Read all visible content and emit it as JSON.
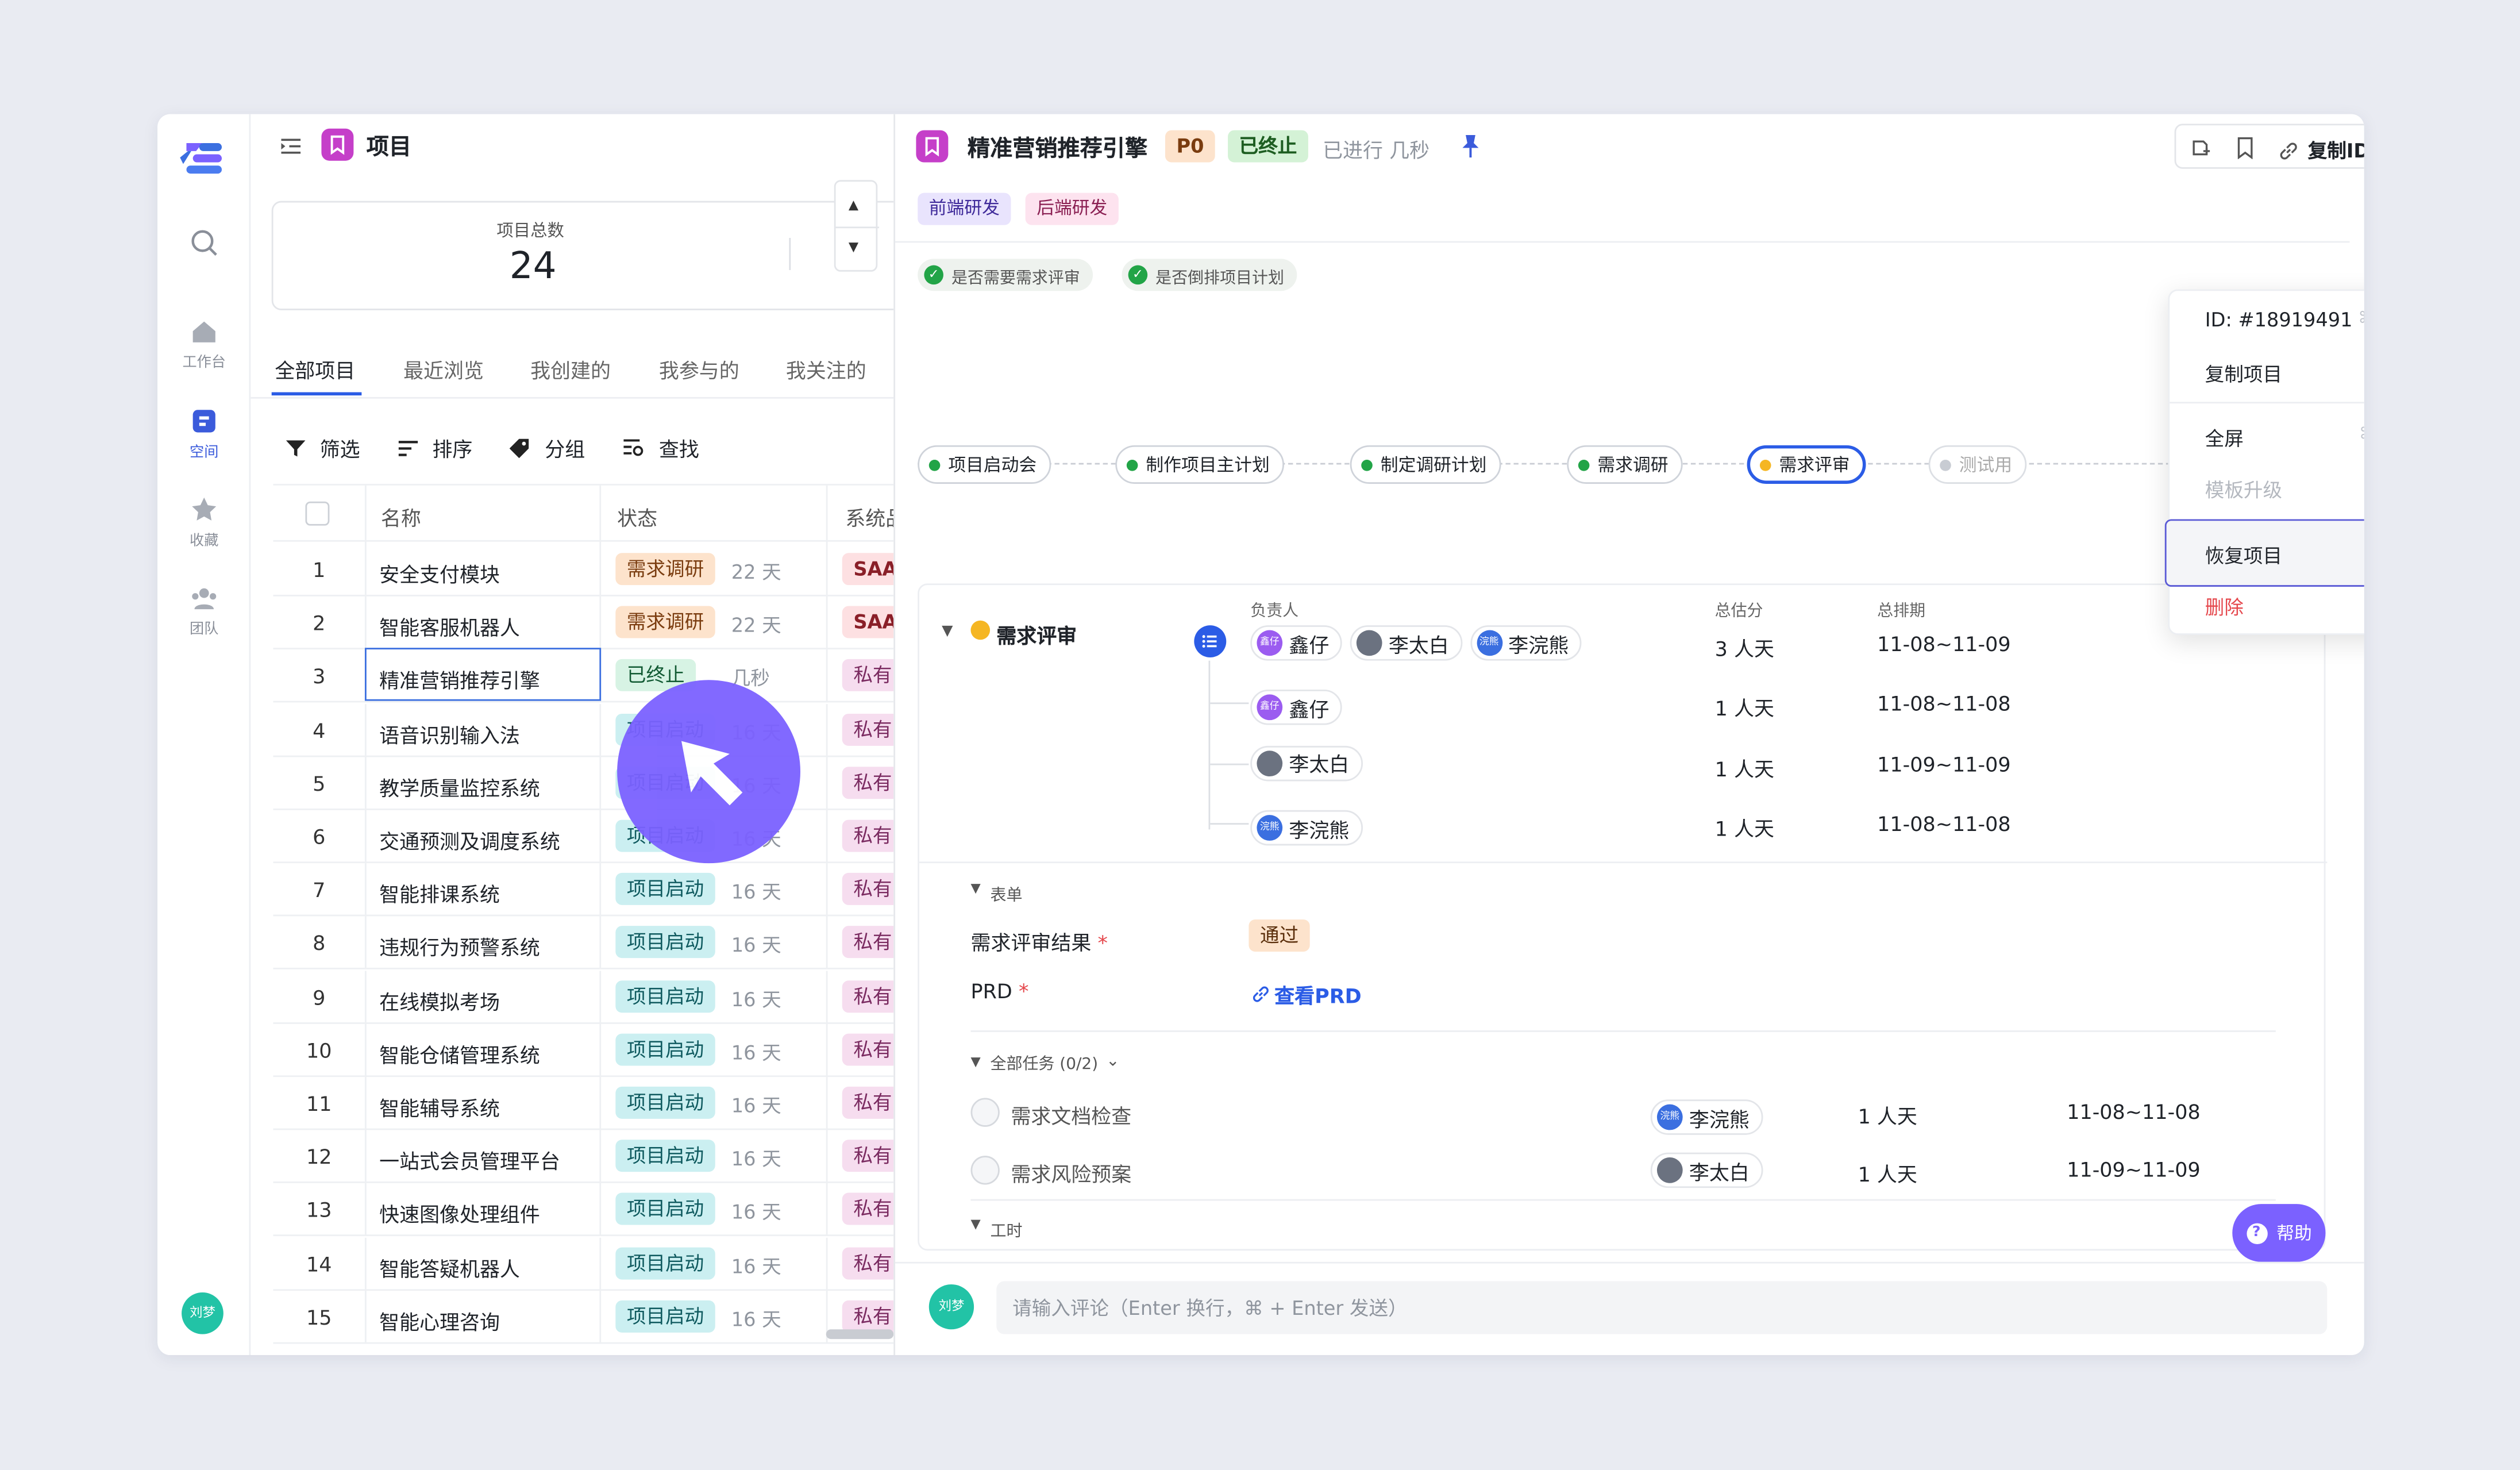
{
  "rail": {
    "items": [
      "工作台",
      "空间",
      "收藏",
      "团队"
    ],
    "user": "刘梦"
  },
  "left": {
    "title": "项目",
    "summary": {
      "label": "项目总数",
      "value": "24"
    },
    "tabs": [
      "全部项目",
      "最近浏览",
      "我创建的",
      "我参与的",
      "我关注的"
    ],
    "toolbar": {
      "filter": "筛选",
      "sort": "排序",
      "group": "分组",
      "find": "查找"
    },
    "columns": {
      "name": "名称",
      "status": "状态",
      "system": "系统品"
    },
    "rows": [
      {
        "no": "1",
        "name": "安全支付模块",
        "status": "需求调研",
        "days": "22 天",
        "sys": "SAA"
      },
      {
        "no": "2",
        "name": "智能客服机器人",
        "status": "需求调研",
        "days": "22 天",
        "sys": "SAA"
      },
      {
        "no": "3",
        "name": "精准营销推荐引擎",
        "status": "已终止",
        "days": "几秒",
        "sys": "私有"
      },
      {
        "no": "4",
        "name": "语音识别输入法",
        "status": "项目启动",
        "days": "16 天",
        "sys": "私有"
      },
      {
        "no": "5",
        "name": "教学质量监控系统",
        "status": "项目启动",
        "days": "16 天",
        "sys": "私有"
      },
      {
        "no": "6",
        "name": "交通预测及调度系统",
        "status": "项目启动",
        "days": "16 天",
        "sys": "私有"
      },
      {
        "no": "7",
        "name": "智能排课系统",
        "status": "项目启动",
        "days": "16 天",
        "sys": "私有"
      },
      {
        "no": "8",
        "name": "违规行为预警系统",
        "status": "项目启动",
        "days": "16 天",
        "sys": "私有"
      },
      {
        "no": "9",
        "name": "在线模拟考场",
        "status": "项目启动",
        "days": "16 天",
        "sys": "私有"
      },
      {
        "no": "10",
        "name": "智能仓储管理系统",
        "status": "项目启动",
        "days": "16 天",
        "sys": "私有"
      },
      {
        "no": "11",
        "name": "智能辅导系统",
        "status": "项目启动",
        "days": "16 天",
        "sys": "私有"
      },
      {
        "no": "12",
        "name": "一站式会员管理平台",
        "status": "项目启动",
        "days": "16 天",
        "sys": "私有"
      },
      {
        "no": "13",
        "name": "快速图像处理组件",
        "status": "项目启动",
        "days": "16 天",
        "sys": "私有"
      },
      {
        "no": "14",
        "name": "智能答疑机器人",
        "status": "项目启动",
        "days": "16 天",
        "sys": "私有"
      },
      {
        "no": "15",
        "name": "智能心理咨询",
        "status": "项目启动",
        "days": "16 天",
        "sys": "私有"
      }
    ]
  },
  "detail": {
    "title": "精准营销推荐引擎",
    "priority": "P0",
    "status": "已终止",
    "elapsed": "已进行 几秒",
    "copy_id": "复制ID",
    "tags": [
      "前端研发",
      "后端研发"
    ],
    "checks": [
      "是否需要需求评审",
      "是否倒排项目计划"
    ],
    "pipeline": [
      {
        "label": "项目启动会",
        "color": "#22a447"
      },
      {
        "label": "制作项目主计划",
        "color": "#22a447"
      },
      {
        "label": "制定调研计划",
        "color": "#22a447"
      },
      {
        "label": "需求调研",
        "color": "#22a447"
      },
      {
        "label": "需求评审",
        "color": "#f5b623"
      },
      {
        "label": "测试用",
        "color": "#c8ccd3"
      }
    ],
    "stage": {
      "name": "需求评审",
      "headers": {
        "owner": "负责人",
        "estimate": "总估分",
        "schedule": "总排期"
      },
      "owners": [
        "鑫仔",
        "李太白",
        "李浣熊"
      ],
      "total": {
        "estimate": "3 人天",
        "schedule": "11-08~11-09"
      },
      "subs": [
        {
          "owner": "鑫仔",
          "estimate": "1 人天",
          "schedule": "11-08~11-08"
        },
        {
          "owner": "李太白",
          "estimate": "1 人天",
          "schedule": "11-09~11-09"
        },
        {
          "owner": "李浣熊",
          "estimate": "1 人天",
          "schedule": "11-08~11-08"
        }
      ]
    },
    "form": {
      "section": "表单",
      "result_label": "需求评审结果",
      "result_value": "通过",
      "prd_label": "PRD",
      "prd_link": "查看PRD"
    },
    "tasks": {
      "section": "全部任务 (0/2)",
      "items": [
        {
          "name": "需求文档检查",
          "owner": "李浣熊",
          "estimate": "1 人天",
          "schedule": "11-08~11-08"
        },
        {
          "name": "需求风险预案",
          "owner": "李太白",
          "estimate": "1 人天",
          "schedule": "11-09~11-09"
        }
      ]
    },
    "hours": {
      "section": "工时"
    },
    "help": "帮助",
    "comment": {
      "avatar": "刘梦",
      "placeholder": "请输入评论（Enter 换行，⌘ + Enter 发送）"
    }
  },
  "menu": {
    "id_label": "ID: #18919491",
    "id_shortcut": "⌘ ⇧ C",
    "copy": "复制项目",
    "fullscreen": "全屏",
    "fullscreen_shortcut": "⌘ ⇧ S",
    "upgrade": "模板升级",
    "restore": "恢复项目",
    "delete": "删除"
  },
  "avatar_initials": {
    "xin": "鑫仔",
    "hx": "浣熊"
  },
  "colors": {
    "accent": "#7b61ff",
    "blue": "#2b5ce6",
    "danger": "#e5484d"
  }
}
